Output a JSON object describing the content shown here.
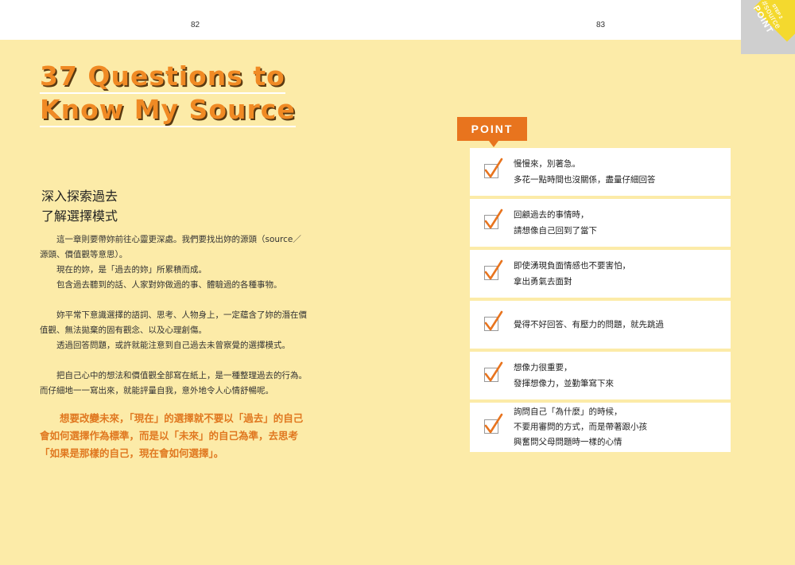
{
  "header": {
    "left_page": "82",
    "right_page": "83"
  },
  "corner_tab": {
    "step": "STEP 2",
    "tag": "#source",
    "label": "POINT"
  },
  "title": {
    "line1": "37 Questions to",
    "line2": "Know My Source"
  },
  "subheading": {
    "line1": "深入探索過去",
    "line2": "了解選擇模式"
  },
  "body": {
    "p1": "這一章則要帶妳前往心靈更深處。我們要找出妳的源頭（source／源頭、價值觀等意思）。",
    "p2": "現在的妳，是「過去的妳」所累積而成。",
    "p3": "包含過去聽到的話、人家對妳做過的事、體驗過的各種事物。",
    "p4": "妳平常下意識選擇的語詞、思考、人物身上，一定蘊含了妳的潛在價值觀、無法拋棄的固有觀念、以及心理創傷。",
    "p5": "透過回答問題，或許就能注意到自己過去未曾察覺的選擇模式。",
    "p6": "把自己心中的想法和價值觀全部寫在紙上，是一種整理過去的行為。而仔細地一一寫出來，就能評量自我，意外地令人心情舒暢呢。"
  },
  "highlight": "想要改變未來，「現在」的選擇就不要以「過去」的自己會如何選擇作為標準，而是以「未來」的自己為準，去思考「如果是那樣的自己，現在會如何選擇」。",
  "point_section": {
    "label": "POINT",
    "items": [
      {
        "line1": "慢慢來，別著急。",
        "line2": "多花一點時間也沒關係，盡量仔細回答",
        "line3": ""
      },
      {
        "line1": "回顧過去的事情時，",
        "line2": "請想像自己回到了當下",
        "line3": ""
      },
      {
        "line1": "即使湧現負面情感也不要害怕，",
        "line2": "拿出勇氣去面對",
        "line3": ""
      },
      {
        "line1": "覺得不好回答、有壓力的問題，就先跳過",
        "line2": "",
        "line3": ""
      },
      {
        "line1": "想像力很重要，",
        "line2": "發揮想像力，並勤筆寫下來",
        "line3": ""
      },
      {
        "line1": "詢問自己「為什麼」的時候，",
        "line2": "不要用審問的方式，而是帶著跟小孩",
        "line3": "興奮問父母問題時一樣的心情"
      }
    ]
  },
  "colors": {
    "page_bg": "#FCEBA8",
    "accent": "#E8741E",
    "title": "#F08A24",
    "card": "#FFFFFF"
  }
}
